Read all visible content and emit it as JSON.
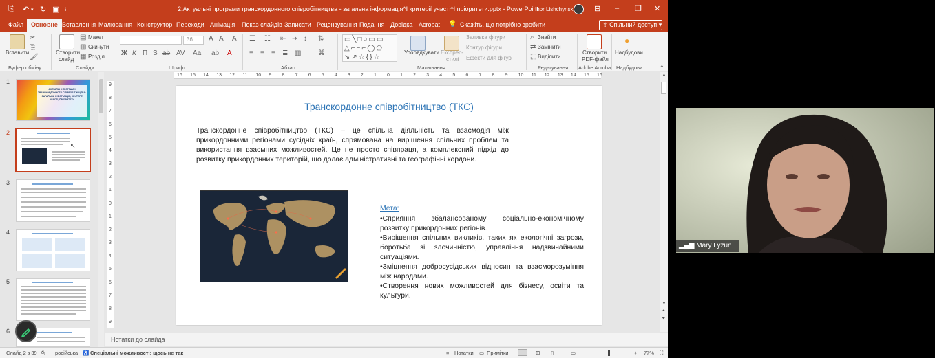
{
  "window": {
    "title": "2.Актуальні програми транскордонного співробітництва - загальна інформація^I критерії участі^I пріоритети.pptx  -  PowerPoint",
    "user": "Ihor Lishchynskyy",
    "accent": "#c43e1c"
  },
  "tabs": {
    "items": [
      "Файл",
      "Основне",
      "Вставлення",
      "Малювання",
      "Конструктор",
      "Переходи",
      "Анімація",
      "Показ слайдів",
      "Записати",
      "Рецензування",
      "Подання",
      "Довідка",
      "Acrobat"
    ],
    "active": "Основне",
    "tell_me": "Скажіть, що потрібно зробити",
    "share": "Спільний доступ"
  },
  "ribbon": {
    "clipboard": {
      "paste": "Вставити",
      "group": "Буфер обміну"
    },
    "slides": {
      "new_slide_1": "Створити",
      "new_slide_2": "слайд",
      "layout": "Макет",
      "reset": "Скинути",
      "section": "Розділ",
      "group": "Слайди"
    },
    "font": {
      "font_size": "36",
      "group": "Шрифт"
    },
    "paragraph": {
      "group": "Абзац"
    },
    "drawing": {
      "arrange": "Упорядкувати",
      "styles_1": "Експрес-",
      "styles_2": "стилі",
      "fill": "Заливка фігури",
      "outline": "Контур фігури",
      "effects": "Ефекти для фігур",
      "group": "Малювання"
    },
    "editing": {
      "find": "Знайти",
      "replace": "Замінити",
      "select": "Виділити",
      "group": "Редагування"
    },
    "acrobat": {
      "create_1": "Створити",
      "create_2": "PDF-файл",
      "group": "Adobe Acrobat"
    },
    "addins": {
      "addins": "Надбудови",
      "group": "Надбудови"
    }
  },
  "ruler": {
    "h_ticks": [
      "16",
      "15",
      "14",
      "13",
      "12",
      "11",
      "10",
      "9",
      "8",
      "7",
      "6",
      "5",
      "4",
      "3",
      "2",
      "1",
      "0",
      "1",
      "2",
      "3",
      "4",
      "5",
      "6",
      "7",
      "8",
      "9",
      "10",
      "11",
      "12",
      "13",
      "14",
      "15",
      "16"
    ],
    "v_ticks": [
      "9",
      "8",
      "7",
      "6",
      "5",
      "4",
      "3",
      "2",
      "1",
      "0",
      "1",
      "2",
      "3",
      "4",
      "5",
      "6",
      "7",
      "8",
      "9"
    ]
  },
  "thumbnails": {
    "numbers": [
      "1",
      "2",
      "3",
      "4",
      "5",
      "6"
    ],
    "selected": "2",
    "slide1_text": "АКТУАЛЬНІ ПРОГРАМИ ТРАНСКОРДОННОГО СПІВРОБІТНИЦТВА: ЗАГАЛЬНА ІНФОРМАЦІЯ, КРИТЕРІЇ УЧАСТІ, ПРІОРИТЕТИ"
  },
  "slide": {
    "title": "Транскордонне співробітництво (ТКС)",
    "paragraph": "Транскордонне співробітництво (ТКС) – це спільна діяльність та взаємодія між прикордонними регіонами сусідніх країн, спрямована на вирішення спільних проблем та використання взаємних можливостей. Це не просто співпраця, а комплексний підхід до розвитку прикордонних територій, що долає адміністративні та географічні кордони.",
    "goal_heading": "Мета:",
    "goals": [
      "•Сприяння збалансованому соціально-економічному розвитку прикордонних регіонів.",
      "•Вирішення спільних викликів, таких як екологічні загрози, боротьба зі злочинністю, управління надзвичайними ситуаціями.",
      "•Зміцнення добросусідських відносин та взаєморозуміння між народами.",
      "•Створення нових можливостей для бізнесу, освіти та культури."
    ]
  },
  "notes": {
    "placeholder": "Нотатки до слайда"
  },
  "status": {
    "slide_of": "Слайд 2 з 39",
    "language": "російська",
    "accessibility": "Спеціальні можливості: щось не так",
    "notes_btn": "Нотатки",
    "comments_btn": "Примітки",
    "zoom": "77%"
  },
  "video": {
    "participant": "Mary Lyzun"
  }
}
